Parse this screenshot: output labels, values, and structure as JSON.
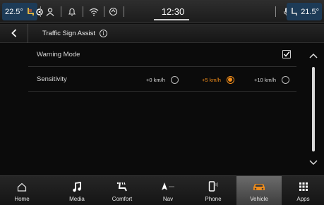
{
  "status_bar": {
    "temp_left": "22.5°",
    "clock": "12:30",
    "temp_right": "21.5°"
  },
  "title_bar": {
    "title": "Traffic Sign Assist"
  },
  "settings": {
    "warning_mode": {
      "label": "Warning Mode",
      "checked": true
    },
    "sensitivity": {
      "label": "Sensitivity",
      "options": [
        "+0 km/h",
        "+5 km/h",
        "+10 km/h"
      ],
      "selected": "+5 km/h"
    }
  },
  "nav": {
    "items": [
      {
        "label": "Home",
        "icon": "home-icon"
      },
      {
        "label": "Media",
        "icon": "music-note-icon"
      },
      {
        "label": "Comfort",
        "icon": "seat-icon"
      },
      {
        "label": "Nav",
        "icon": "navigation-arrow-icon"
      },
      {
        "label": "Phone",
        "icon": "phone-icon"
      },
      {
        "label": "Vehicle",
        "icon": "car-icon"
      },
      {
        "label": "Apps",
        "icon": "apps-grid-icon"
      }
    ],
    "active": "Vehicle"
  },
  "colors": {
    "accent": "#f08c1a",
    "temp_badge": "#1d3b57",
    "background": "#0b0b0b"
  }
}
